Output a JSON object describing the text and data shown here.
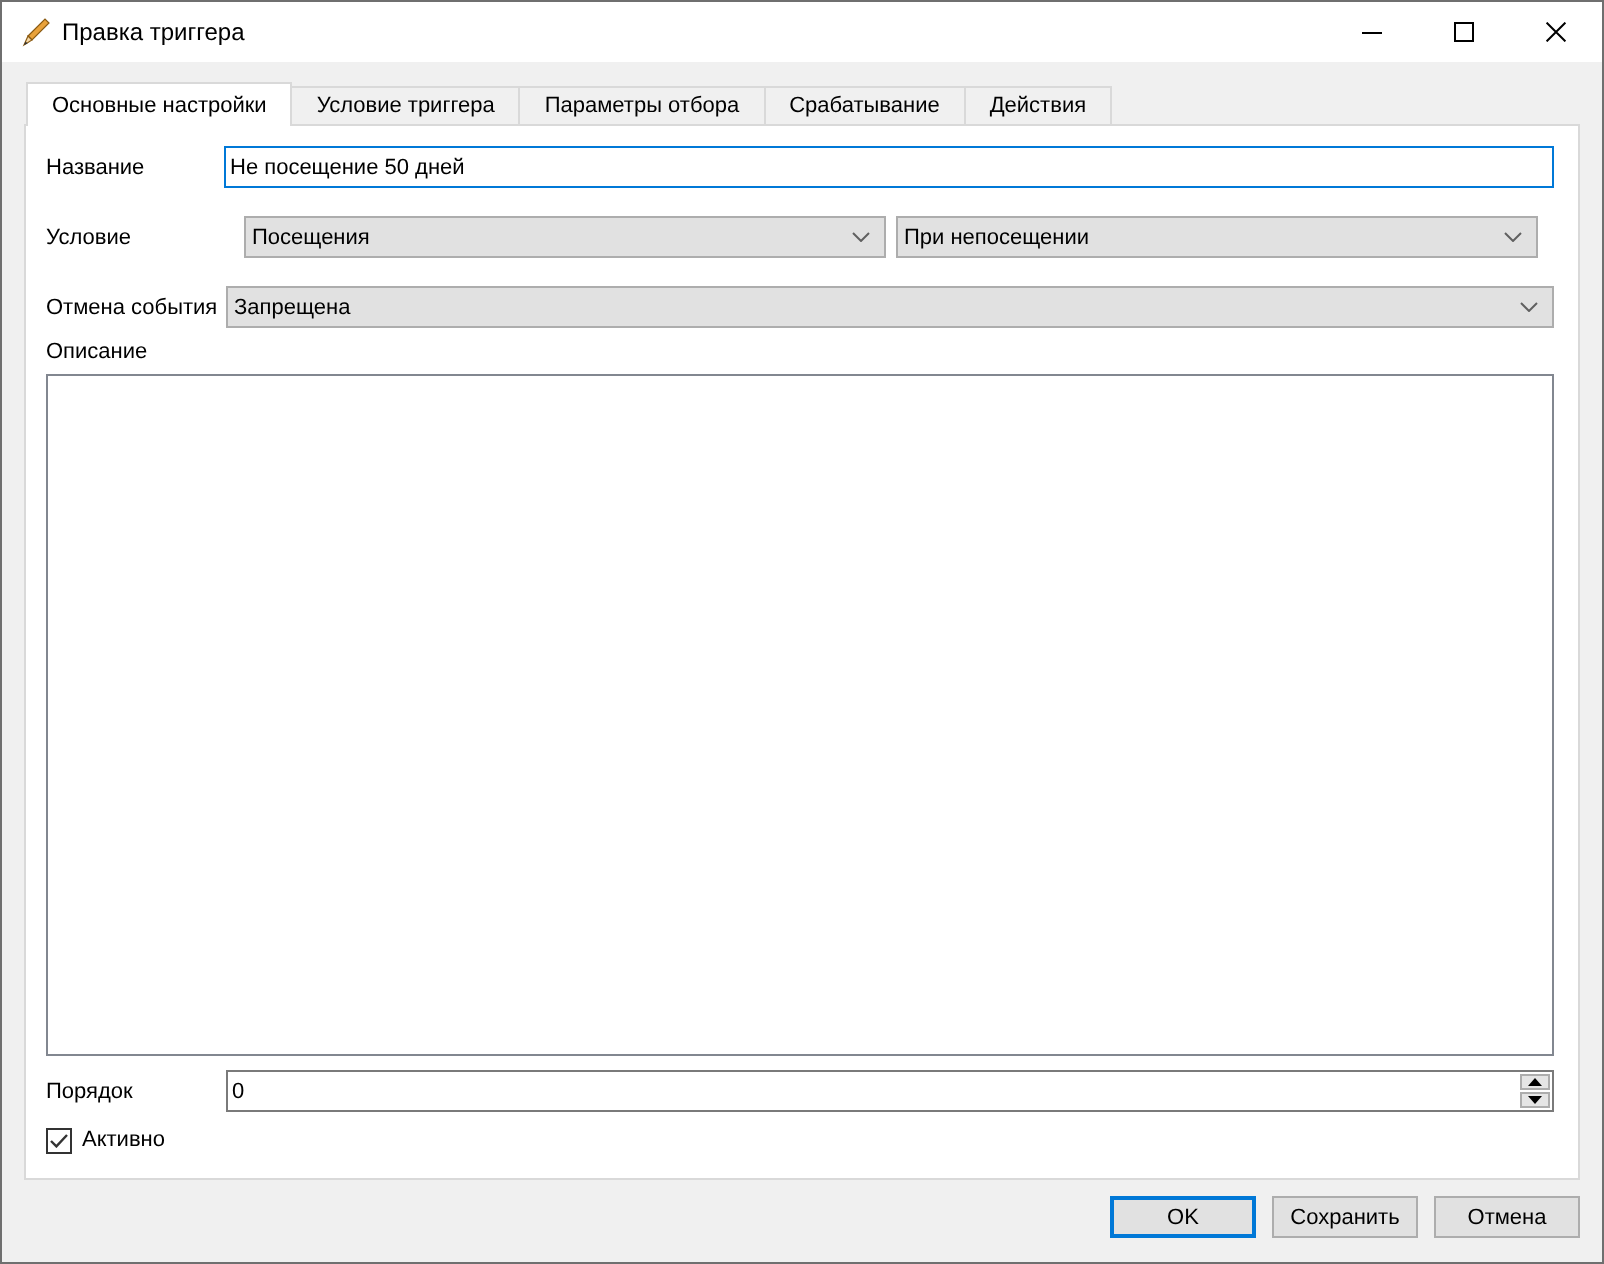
{
  "window": {
    "title": "Правка триггера"
  },
  "tabs": [
    {
      "label": "Основные настройки",
      "selected": true
    },
    {
      "label": "Условие триггера",
      "selected": false
    },
    {
      "label": "Параметры отбора",
      "selected": false
    },
    {
      "label": "Срабатывание",
      "selected": false
    },
    {
      "label": "Действия",
      "selected": false
    }
  ],
  "form": {
    "name": {
      "label": "Название",
      "value": "Не посещение 50 дней",
      "focused": true
    },
    "condition": {
      "label": "Условие",
      "selects": [
        {
          "value": "Посещения"
        },
        {
          "value": "При непосещении"
        }
      ]
    },
    "cancel_event": {
      "label": "Отмена события",
      "value": "Запрещена"
    },
    "description": {
      "label": "Описание"
    },
    "order": {
      "label": "Порядок",
      "value": "0"
    },
    "active": {
      "label": "Активно",
      "checked": true
    }
  },
  "buttons": [
    {
      "label": "OK",
      "default": true
    },
    {
      "label": "Сохранить",
      "default": false
    },
    {
      "label": "Отмена",
      "default": false
    }
  ]
}
